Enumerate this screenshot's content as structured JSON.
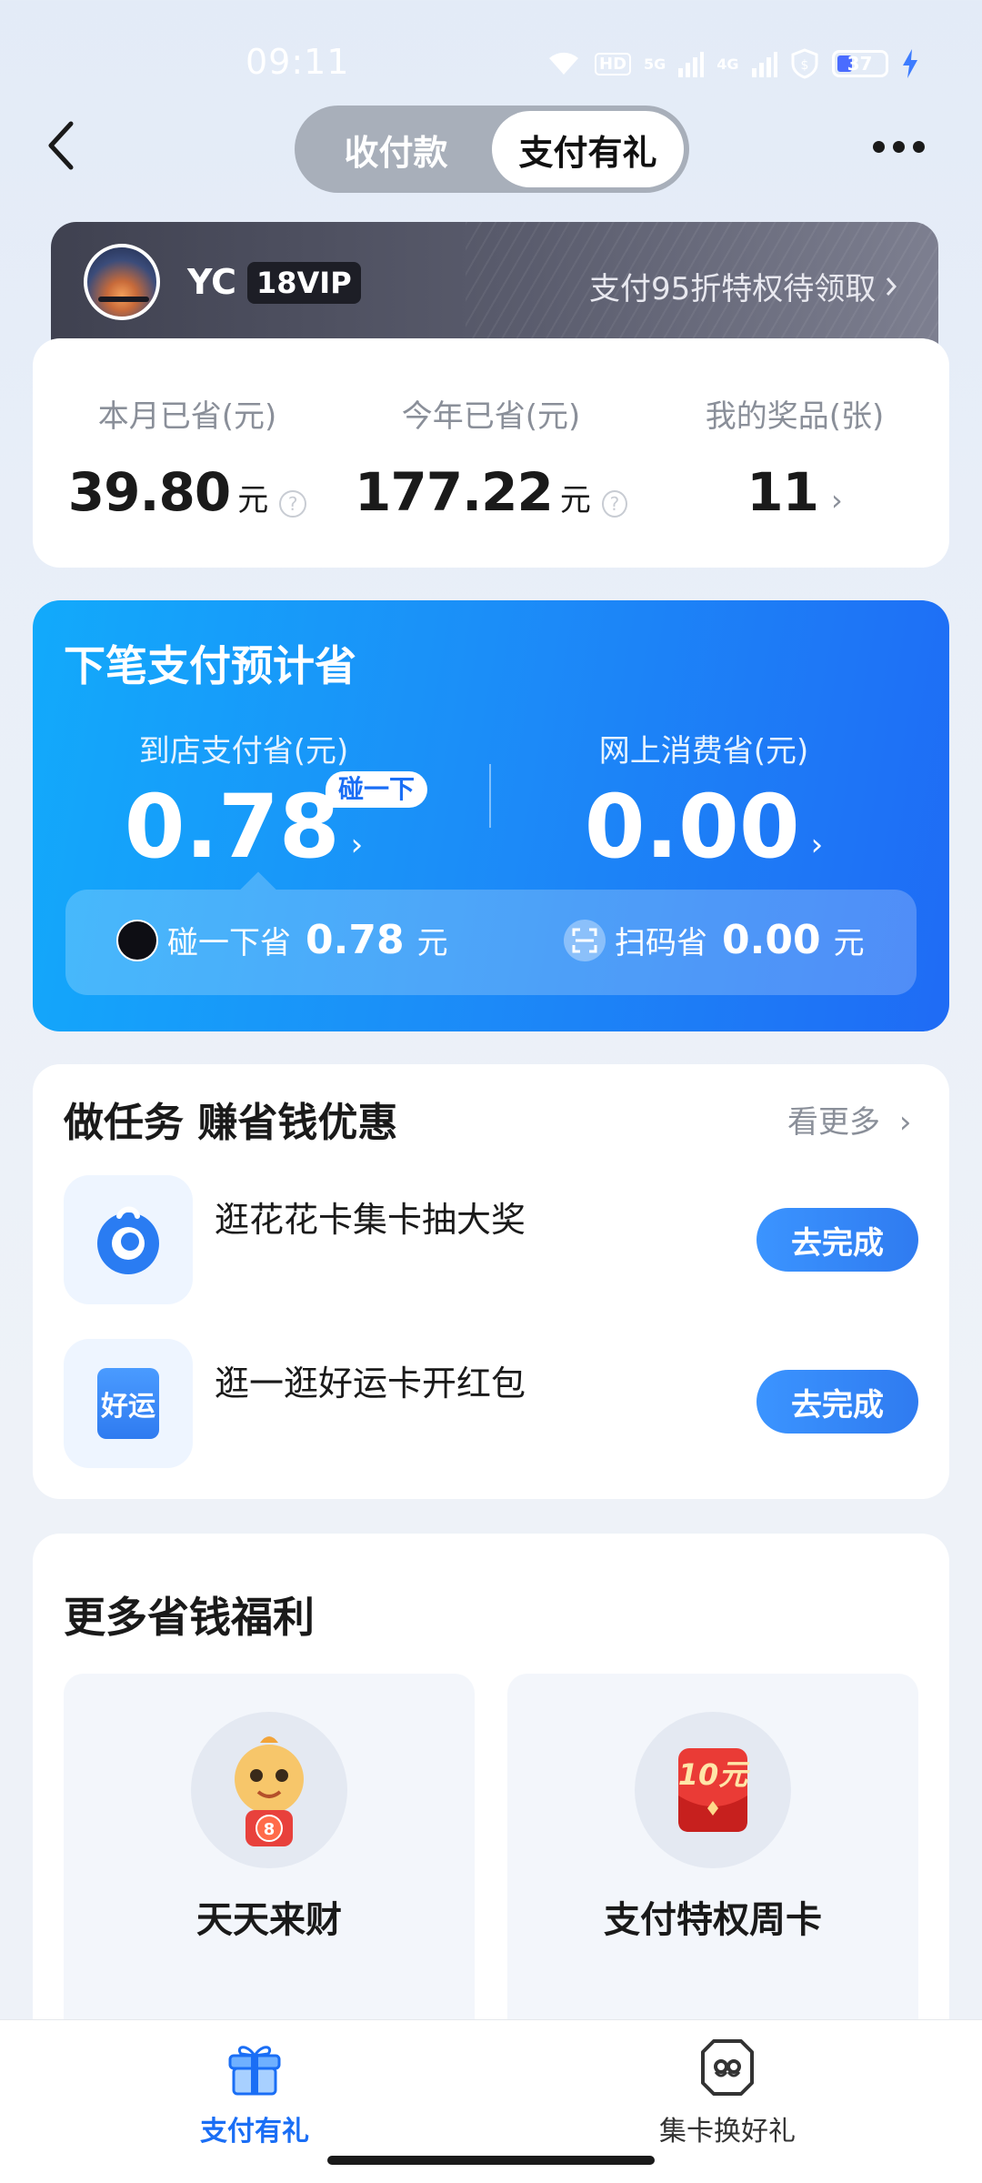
{
  "status_bar": {
    "time": "09:11",
    "hd": "HD",
    "net1": "5G",
    "net2": "4G",
    "battery": "37"
  },
  "nav": {
    "tabs": [
      {
        "label": "收付款",
        "active": false
      },
      {
        "label": "支付有礼",
        "active": true
      }
    ]
  },
  "vip": {
    "name": "YC",
    "level": "18VIP",
    "promo": "支付95折特权待领取"
  },
  "stats": [
    {
      "label": "本月已省(元)",
      "value": "39.80",
      "unit": "元"
    },
    {
      "label": "今年已省(元)",
      "value": "177.22",
      "unit": "元"
    },
    {
      "label": "我的奖品(张)",
      "value": "11"
    }
  ],
  "next_pay": {
    "title": "下笔支付预计省",
    "store": {
      "label": "到店支付省(元)",
      "value": "0.78",
      "tag": "碰一下"
    },
    "online": {
      "label": "网上消费省(元)",
      "value": "0.00"
    },
    "tap": {
      "label": "碰一下省",
      "value": "0.78",
      "unit": "元"
    },
    "scan": {
      "label": "扫码省",
      "value": "0.00",
      "unit": "元"
    }
  },
  "tasks": {
    "title": "做任务 赚省钱优惠",
    "more": "看更多",
    "items": [
      {
        "name": "逛花花卡集卡抽大奖",
        "button": "去完成"
      },
      {
        "name": "逛一逛好运卡开红包",
        "button": "去完成",
        "icon_text": "好运"
      }
    ]
  },
  "benefits": {
    "title": "更多省钱福利",
    "items": [
      {
        "label": "天天来财",
        "badge": "8"
      },
      {
        "label": "支付特权周卡",
        "badge": "10元"
      }
    ]
  },
  "tabbar": {
    "items": [
      {
        "label": "支付有礼",
        "active": true
      },
      {
        "label": "集卡换好礼",
        "active": false
      }
    ]
  },
  "colors": {
    "primary_blue": "#1a6ef5",
    "card_gradient_start": "#12aafb",
    "card_gradient_end": "#1f6bf5"
  }
}
